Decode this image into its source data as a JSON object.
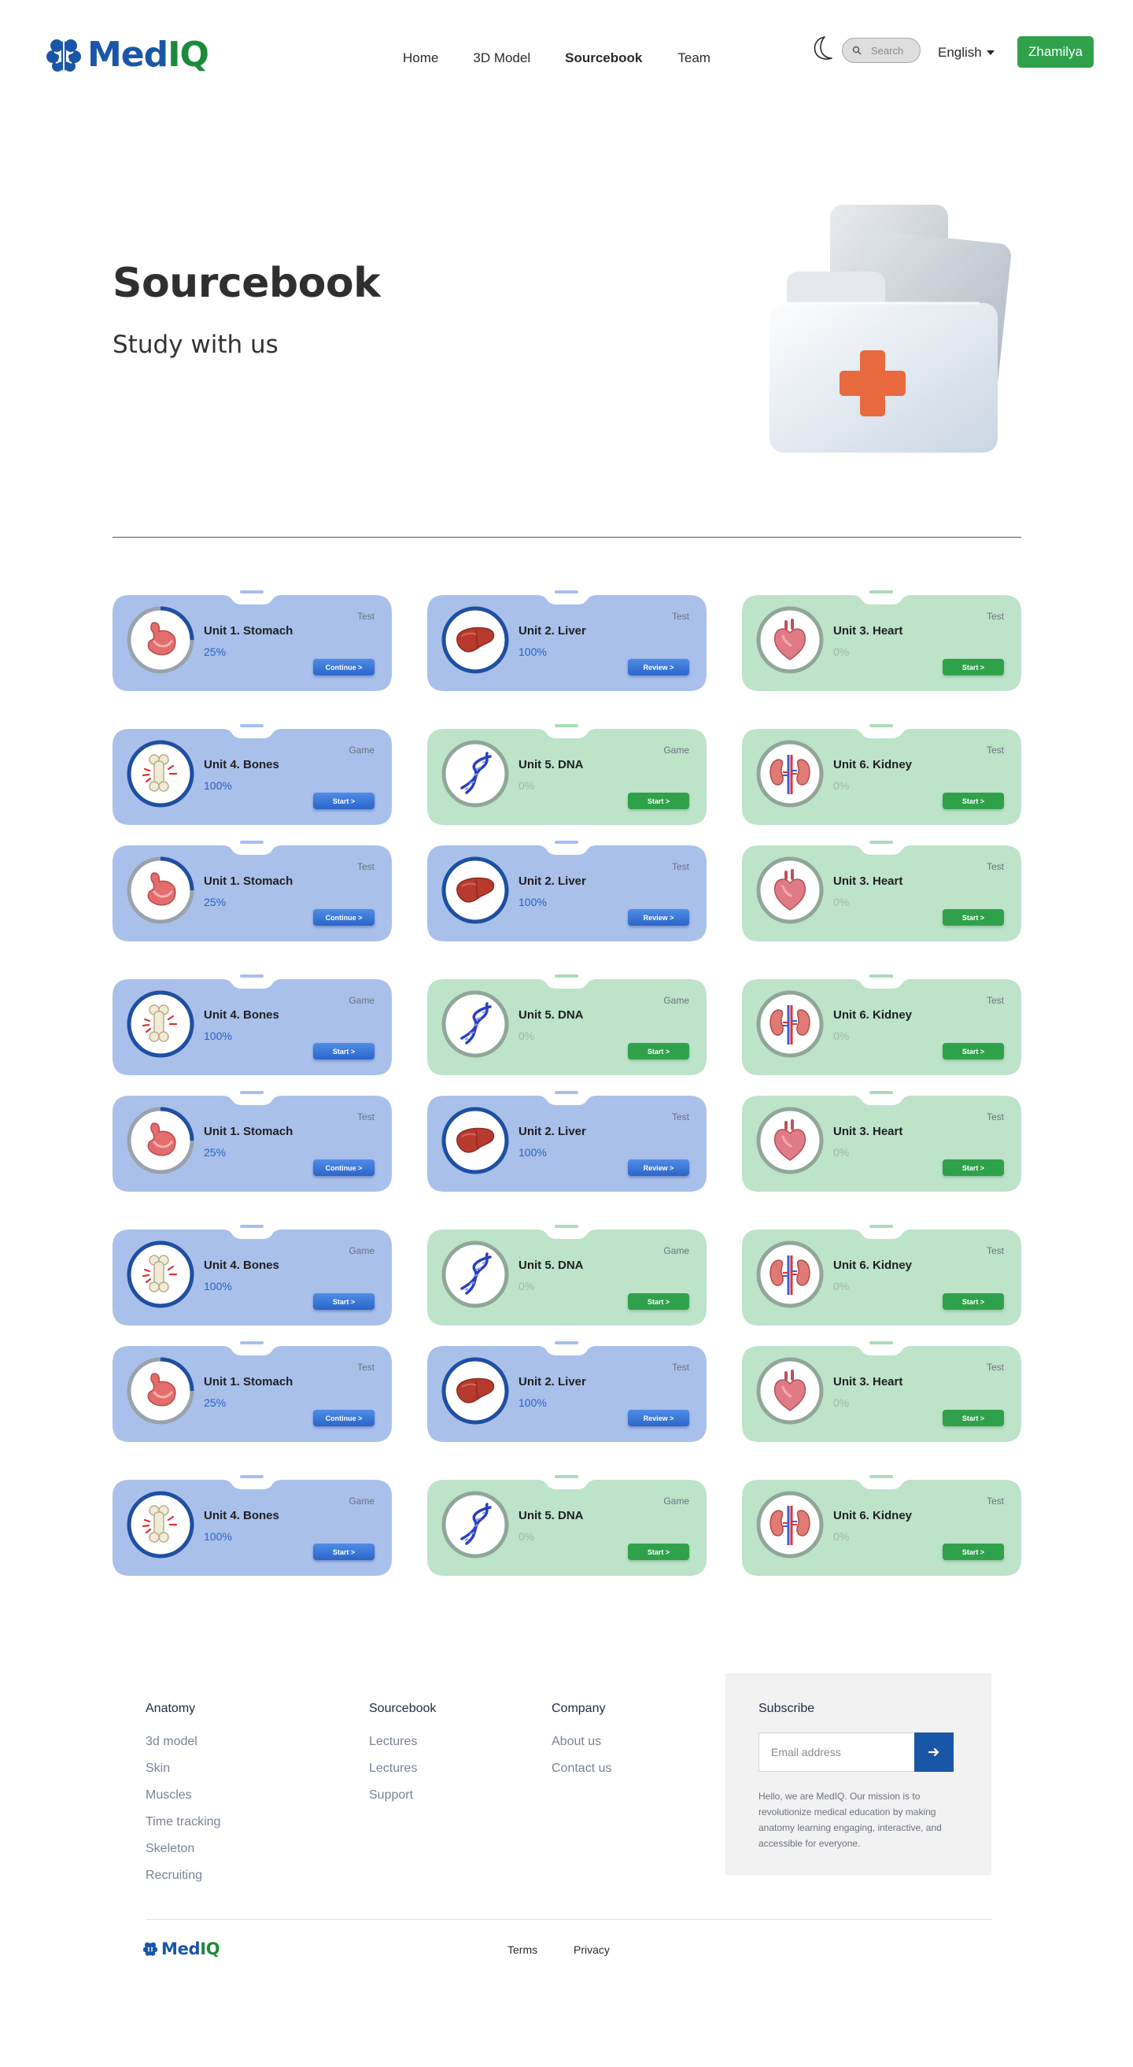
{
  "brand": {
    "name_part1": "Med",
    "name_part2": "IQ",
    "primary": "#1a56a8",
    "accent": "#1d8a3a"
  },
  "nav": {
    "items": [
      "Home",
      "3D Model",
      "Sourcebook",
      "Team"
    ],
    "active": "Sourcebook"
  },
  "header": {
    "search_placeholder": "Search",
    "language": "English",
    "user": "Zhamilya"
  },
  "hero": {
    "title": "Sourcebook",
    "subtitle": "Study with us",
    "illustration": "first-aid-folder-icon"
  },
  "cards": [
    {
      "title": "Unit 1. Stomach",
      "percent": "25%",
      "progress": 0.25,
      "type": "Test",
      "action": "Continue >",
      "theme": "blue",
      "icon": "stomach-icon"
    },
    {
      "title": "Unit 2. Liver",
      "percent": "100%",
      "progress": 1.0,
      "type": "Test",
      "action": "Review >",
      "theme": "blue",
      "icon": "liver-icon"
    },
    {
      "title": "Unit 3. Heart",
      "percent": "0%",
      "progress": 0,
      "type": "Test",
      "action": "Start >",
      "theme": "green",
      "icon": "heart-icon"
    },
    {
      "title": "Unit 4. Bones",
      "percent": "100%",
      "progress": 1.0,
      "type": "Game",
      "action": "Start >",
      "theme": "blue",
      "icon": "bone-icon"
    },
    {
      "title": "Unit 5. DNA",
      "percent": "0%",
      "progress": 0,
      "type": "Game",
      "action": "Start >",
      "theme": "green",
      "icon": "dna-icon"
    },
    {
      "title": "Unit 6. Kidney",
      "percent": "0%",
      "progress": 0,
      "type": "Test",
      "action": "Start >",
      "theme": "green",
      "icon": "kidney-icon"
    },
    {
      "title": "Unit 1. Stomach",
      "percent": "25%",
      "progress": 0.25,
      "type": "Test",
      "action": "Continue >",
      "theme": "blue",
      "icon": "stomach-icon"
    },
    {
      "title": "Unit 2. Liver",
      "percent": "100%",
      "progress": 1.0,
      "type": "Test",
      "action": "Review >",
      "theme": "blue",
      "icon": "liver-icon"
    },
    {
      "title": "Unit 3. Heart",
      "percent": "0%",
      "progress": 0,
      "type": "Test",
      "action": "Start >",
      "theme": "green",
      "icon": "heart-icon"
    },
    {
      "title": "Unit 4. Bones",
      "percent": "100%",
      "progress": 1.0,
      "type": "Game",
      "action": "Start >",
      "theme": "blue",
      "icon": "bone-icon"
    },
    {
      "title": "Unit 5. DNA",
      "percent": "0%",
      "progress": 0,
      "type": "Game",
      "action": "Start >",
      "theme": "green",
      "icon": "dna-icon"
    },
    {
      "title": "Unit 6. Kidney",
      "percent": "0%",
      "progress": 0,
      "type": "Test",
      "action": "Start >",
      "theme": "green",
      "icon": "kidney-icon"
    },
    {
      "title": "Unit 1. Stomach",
      "percent": "25%",
      "progress": 0.25,
      "type": "Test",
      "action": "Continue >",
      "theme": "blue",
      "icon": "stomach-icon"
    },
    {
      "title": "Unit 2. Liver",
      "percent": "100%",
      "progress": 1.0,
      "type": "Test",
      "action": "Review >",
      "theme": "blue",
      "icon": "liver-icon"
    },
    {
      "title": "Unit 3. Heart",
      "percent": "0%",
      "progress": 0,
      "type": "Test",
      "action": "Start >",
      "theme": "green",
      "icon": "heart-icon"
    },
    {
      "title": "Unit 4. Bones",
      "percent": "100%",
      "progress": 1.0,
      "type": "Game",
      "action": "Start >",
      "theme": "blue",
      "icon": "bone-icon"
    },
    {
      "title": "Unit 5. DNA",
      "percent": "0%",
      "progress": 0,
      "type": "Game",
      "action": "Start >",
      "theme": "green",
      "icon": "dna-icon"
    },
    {
      "title": "Unit 6. Kidney",
      "percent": "0%",
      "progress": 0,
      "type": "Test",
      "action": "Start >",
      "theme": "green",
      "icon": "kidney-icon"
    },
    {
      "title": "Unit 1. Stomach",
      "percent": "25%",
      "progress": 0.25,
      "type": "Test",
      "action": "Continue >",
      "theme": "blue",
      "icon": "stomach-icon"
    },
    {
      "title": "Unit 2. Liver",
      "percent": "100%",
      "progress": 1.0,
      "type": "Test",
      "action": "Review >",
      "theme": "blue",
      "icon": "liver-icon"
    },
    {
      "title": "Unit 3. Heart",
      "percent": "0%",
      "progress": 0,
      "type": "Test",
      "action": "Start >",
      "theme": "green",
      "icon": "heart-icon"
    },
    {
      "title": "Unit 4. Bones",
      "percent": "100%",
      "progress": 1.0,
      "type": "Game",
      "action": "Start >",
      "theme": "blue",
      "icon": "bone-icon"
    },
    {
      "title": "Unit 5. DNA",
      "percent": "0%",
      "progress": 0,
      "type": "Game",
      "action": "Start >",
      "theme": "green",
      "icon": "dna-icon"
    },
    {
      "title": "Unit 6. Kidney",
      "percent": "0%",
      "progress": 0,
      "type": "Test",
      "action": "Start >",
      "theme": "green",
      "icon": "kidney-icon"
    }
  ],
  "card_colors": {
    "blue": "#a9c0eb",
    "green": "#bde3c9",
    "ring_blue": "#1d4fa3",
    "ring_track": "#9aa2ab",
    "ring_green": "#8fa699"
  },
  "footer": {
    "columns": [
      {
        "heading": "Anatomy",
        "links": [
          "3d model",
          "Skin",
          "Muscles",
          "Time tracking",
          "Skeleton",
          "Recruiting"
        ]
      },
      {
        "heading": "Sourcebook",
        "links": [
          "Lectures",
          "Lectures",
          "Support"
        ]
      },
      {
        "heading": "Company",
        "links": [
          "About us",
          "Contact us"
        ]
      }
    ],
    "subscribe": {
      "heading": "Subscribe",
      "email_placeholder": "Email address",
      "blurb": "Hello, we are MedIQ. Our mission is to revolutionize medical education by making anatomy learning engaging, interactive, and accessible for everyone."
    },
    "bottom_links": [
      "Terms",
      "Privacy"
    ]
  }
}
